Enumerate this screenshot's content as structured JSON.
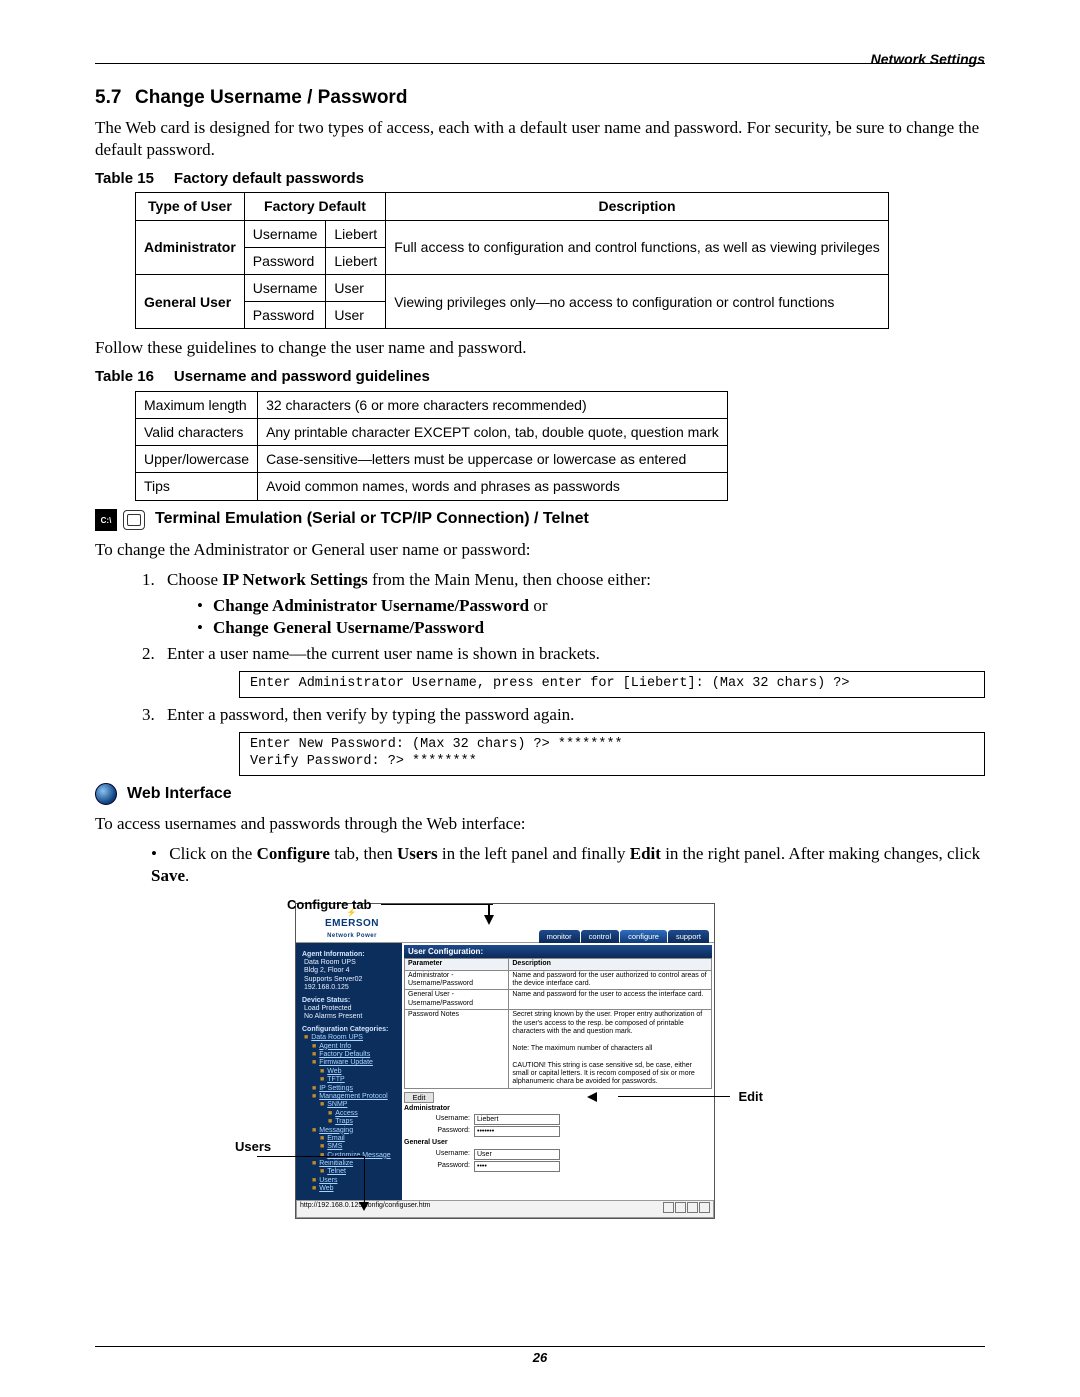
{
  "header": {
    "right": "Network Settings"
  },
  "section": {
    "number": "5.7",
    "title": "Change Username / Password"
  },
  "intro": "The Web card is designed for two types of access, each with a default user name and password. For security, be sure to change the default password.",
  "table15": {
    "caption_num": "Table 15",
    "caption_title": "Factory default passwords",
    "headers": {
      "type": "Type of User",
      "default": "Factory Default",
      "desc": "Description"
    },
    "rows": {
      "admin_label": "Administrator",
      "admin_user_field": "Username",
      "admin_user_val": "Liebert",
      "admin_pass_field": "Password",
      "admin_pass_val": "Liebert",
      "admin_desc": "Full access to configuration and control functions, as well as viewing privileges",
      "gen_label": "General User",
      "gen_user_field": "Username",
      "gen_user_val": "User",
      "gen_pass_field": "Password",
      "gen_pass_val": "User",
      "gen_desc": "Viewing privileges only—no access to configuration or control functions"
    }
  },
  "follow_text": "Follow these guidelines to change the user name and password.",
  "table16": {
    "caption_num": "Table 16",
    "caption_title": "Username and password guidelines",
    "rows": [
      {
        "k": "Maximum length",
        "v": "32 characters (6 or more characters recommended)"
      },
      {
        "k": "Valid characters",
        "v": "Any printable character EXCEPT colon, tab, double quote, question mark"
      },
      {
        "k": "Upper/lowercase",
        "v": "Case-sensitive—letters must be uppercase or lowercase as entered"
      },
      {
        "k": "Tips",
        "v": "Avoid common names, words and phrases as passwords"
      }
    ]
  },
  "terminal": {
    "heading": "Terminal Emulation (Serial or TCP/IP Connection) / Telnet",
    "intro": "To change the Administrator or General user name or password:",
    "step1_a": "Choose ",
    "step1_b": "IP Network Settings",
    "step1_c": " from the Main Menu, then choose either:",
    "sub1": "Change Administrator Username/Password",
    "sub1_or": " or",
    "sub2": "Change General Username/Password",
    "step2": "Enter a user name—the current user name is shown in brackets.",
    "code1": "Enter Administrator Username, press enter for [Liebert]: (Max 32 chars) ?>",
    "step3": "Enter a password, then verify by typing the password again.",
    "code2": "Enter New Password: (Max 32 chars) ?> ********\nVerify Password: ?> ********"
  },
  "web": {
    "heading": "Web Interface",
    "intro": "To access usernames and passwords through the Web interface:",
    "bullet_parts": {
      "a": "Click on the ",
      "b": "Configure",
      "c": " tab, then ",
      "d": "Users",
      "e": " in the left panel and finally ",
      "f": "Edit",
      "g": " in the right panel. After making changes, click ",
      "h": "Save",
      "i": "."
    }
  },
  "shot": {
    "labels": {
      "configure": "Configure tab",
      "users": "Users",
      "edit": "Edit"
    },
    "logo_brand": "EMERSON",
    "logo_sub": "Network Power",
    "tabs": {
      "monitor": "monitor",
      "control": "control",
      "configure": "configure",
      "support": "support"
    },
    "side": {
      "agent_info_hdr": "Agent Information:",
      "ai1": "Data Room UPS",
      "ai2": "Bldg 2, Floor 4",
      "ai3": "Supports Server02",
      "ai4": "192.168.0.125",
      "device_hdr": "Device Status:",
      "ds1": "Load Protected",
      "ds2": "No Alarms Present",
      "cfg_hdr": "Configuration Categories:",
      "root": "Data Room UPS",
      "n1": "Agent Info",
      "n2": "Factory Defaults",
      "n3": "Firmware Update",
      "n3a": "Web",
      "n3b": "TFTP",
      "n4": "IP Settings",
      "n5": "Management Protocol",
      "n5a": "SNMP",
      "n5a1": "Access",
      "n5a2": "Traps",
      "n6": "Messaging",
      "n6a": "Email",
      "n6b": "SMS",
      "n6c": "Customize Message",
      "n7": "Reinitialize",
      "n7a": "Telnet",
      "n8": "Users",
      "n9": "Web"
    },
    "main": {
      "titlebar": "User Configuration:",
      "th_param": "Parameter",
      "th_desc": "Description",
      "r1_k": "Administrator - Username/Password",
      "r1_v": "Name and password for the user authorized to control areas of the device interface card.",
      "r2_k": "General User - Username/Password",
      "r2_v": "Name and password for the user to access the interface card.",
      "r3_k": "Password Notes",
      "r3_v": "Secret string known by the user. Proper entry authorization of the user's access to the resp. be composed of printable characters with the and question mark.\n\nNote: The maximum number of characters all\n\nCAUTION! This string is case sensitive sd, be case, either small or capital letters. It is recom composed of six or more alphanumeric chara be avoided for passwords.",
      "edit_btn": "Edit",
      "grp_admin": "Administrator",
      "grp_gen": "General User",
      "f_user": "Username:",
      "f_pass": "Password:",
      "v_admin_user": "Liebert",
      "v_admin_pass": "•••••••",
      "v_gen_user": "User",
      "v_gen_pass": "••••",
      "statusbar_url": "http://192.168.0.125/config/configuser.htm"
    }
  },
  "page_number": "26"
}
